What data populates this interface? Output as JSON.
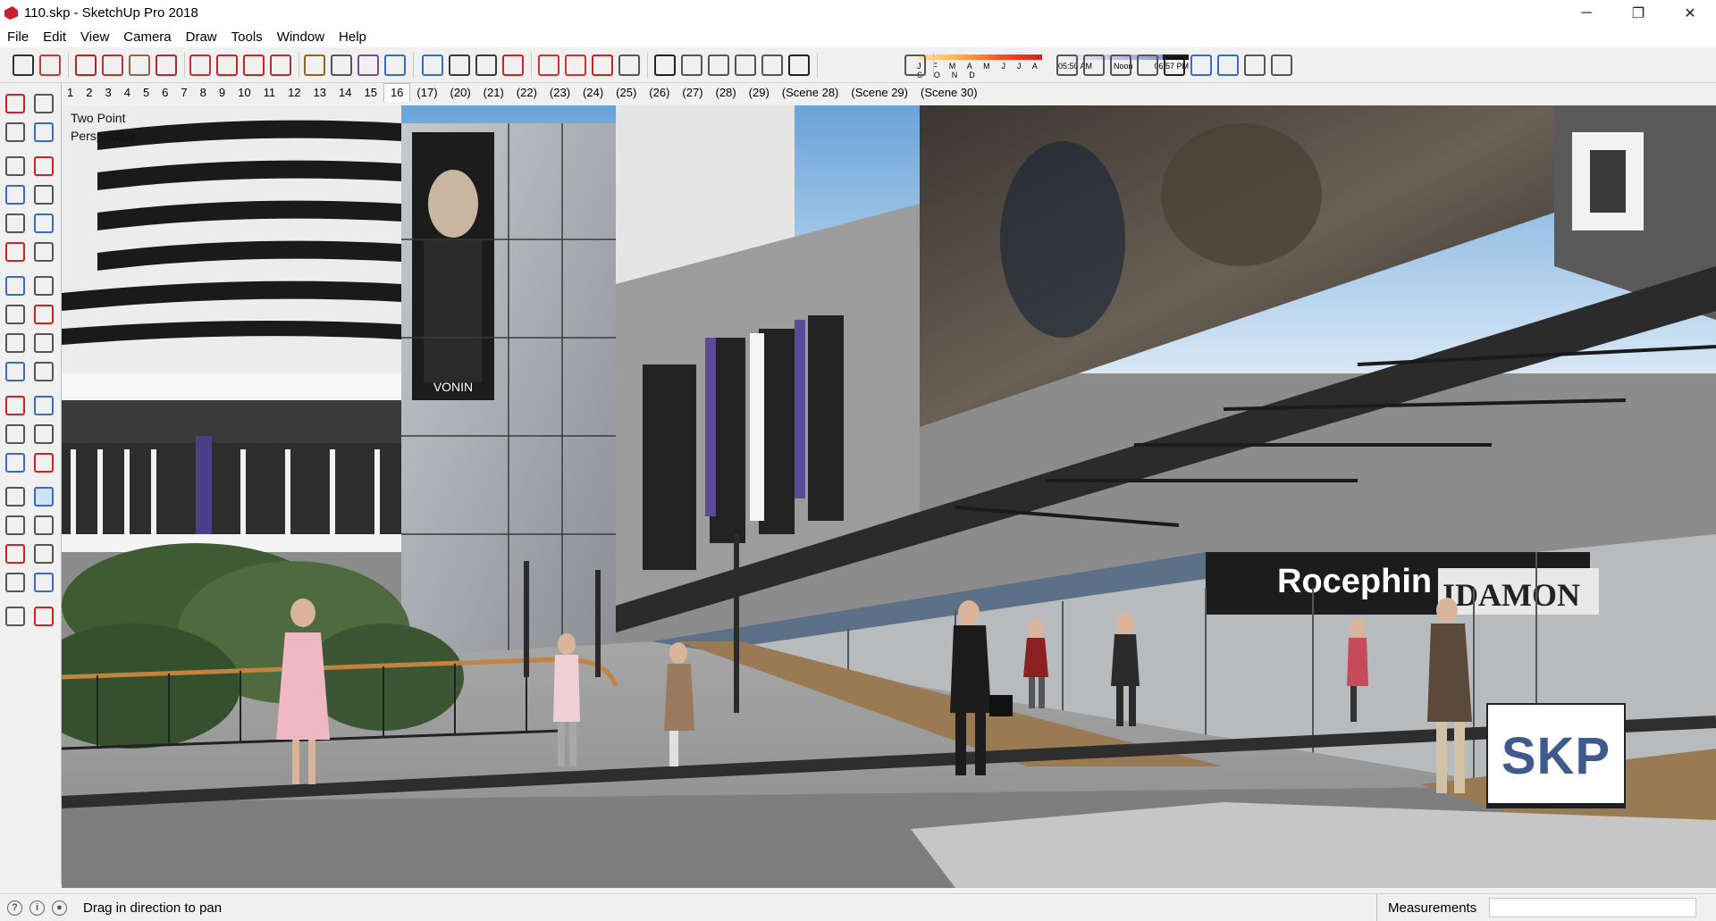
{
  "window": {
    "title": "110.skp - SketchUp Pro 2018",
    "minimize": "─",
    "maximize": "❐",
    "close": "✕"
  },
  "menu": [
    "File",
    "Edit",
    "View",
    "Camera",
    "Draw",
    "Tools",
    "Window",
    "Help"
  ],
  "toolbar": {
    "icons": [
      "select-icon",
      "eraser-icon",
      "line-icon",
      "arc-icon",
      "rectangle-icon",
      "push-pull-icon",
      "follow-me-icon",
      "move-icon",
      "rotate-icon",
      "scale-icon",
      "tape-measure-icon",
      "text-icon",
      "paint-bucket-icon",
      "orbit-icon",
      "pan-icon",
      "zoom-icon",
      "zoom-extents-icon",
      "warehouse-icon",
      "extension-warehouse-icon",
      "layout-icon",
      "ruby-icon",
      "iso-view-icon",
      "top-view-icon",
      "front-view-icon",
      "right-view-icon",
      "back-view-icon",
      "left-view-icon",
      "shadows-icon",
      "xray-icon",
      "back-edges-icon",
      "wireframe-icon",
      "hidden-line-icon",
      "shaded-icon",
      "shaded-textures-icon",
      "monochrome-icon",
      "style-builder-icon",
      "sandbox-icon",
      "photomatch-icon"
    ],
    "shadow_months": "J F M A M J J A S O N D",
    "time_start": "05:50 AM",
    "time_mid": "Noon",
    "time_end": "06:57 PM"
  },
  "scenes": [
    "1",
    "2",
    "3",
    "4",
    "5",
    "6",
    "7",
    "8",
    "9",
    "10",
    "11",
    "12",
    "13",
    "14",
    "15",
    "16",
    "(17)",
    "(20)",
    "(21)",
    "(22)",
    "(23)",
    "(24)",
    "(25)",
    "(26)",
    "(27)",
    "(28)",
    "(29)",
    "(Scene 28)",
    "(Scene 29)",
    "(Scene 30)"
  ],
  "active_scene": "16",
  "viewport": {
    "camera_line1": "Two Point",
    "camera_line2": "Perspective",
    "sign_text": "Rocephin",
    "sign_text2": "IDAMON",
    "billboard_text": "VONIN",
    "logo": "SKP"
  },
  "status": {
    "message": "Drag in direction to pan",
    "measurements_label": "Measurements",
    "measurements_value": ""
  },
  "left_tools": [
    "select-icon",
    "component-icon",
    "paint-icon",
    "eraser-icon",
    "line-icon",
    "freehand-icon",
    "rectangle-icon",
    "rotated-rect-icon",
    "circle-icon",
    "polygon-icon",
    "arc-icon",
    "pie-icon",
    "three-point-arc-icon",
    "two-point-arc-icon",
    "move-icon",
    "push-pull-icon",
    "rotate-icon",
    "follow-me-icon",
    "scale-icon",
    "offset-icon",
    "tape-icon",
    "dimension-icon",
    "protractor-icon",
    "text-icon",
    "axes-icon",
    "3d-text-icon",
    "orbit-icon",
    "pan-icon",
    "zoom-icon",
    "zoom-window-icon",
    "zoom-extents-icon",
    "previous-view-icon",
    "position-camera-icon",
    "look-around-icon",
    "walk-icon",
    "section-plane-icon"
  ]
}
